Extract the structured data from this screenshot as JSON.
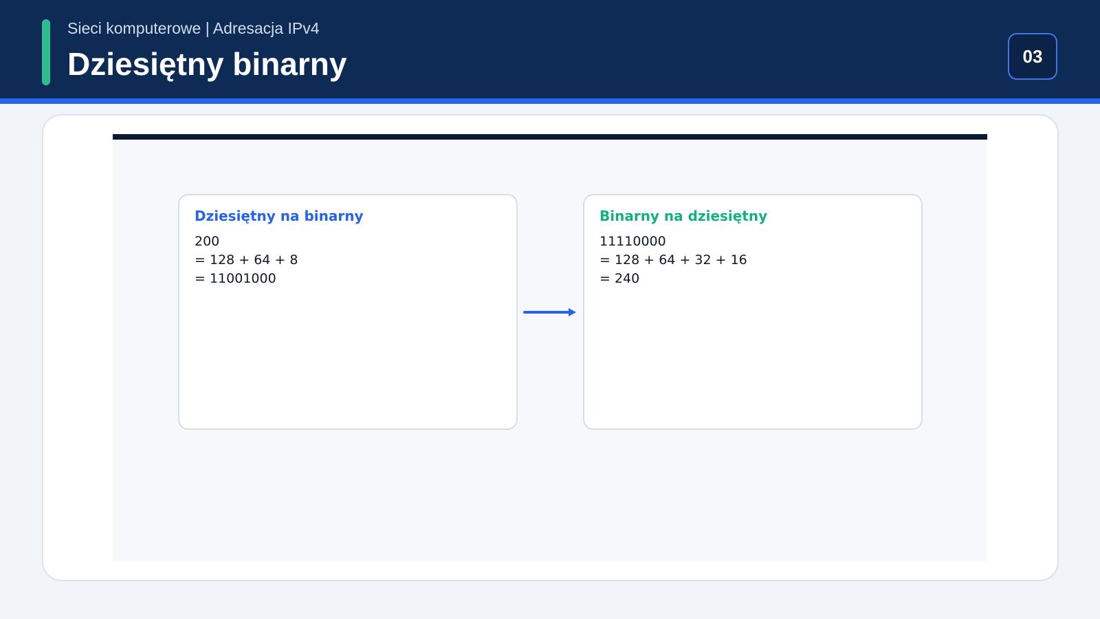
{
  "header": {
    "subtitle": "Sieci komputerowe | Adresacja IPv4",
    "title": "Dziesiętny binarny",
    "page_number": "03"
  },
  "colors": {
    "header_bg": "#0d2b55",
    "header_stripe": "#2563eb",
    "accent": "#2ebd90",
    "left_title": "#2563eb",
    "right_title": "#14b27a"
  },
  "cards": [
    {
      "title": "Dziesiętny na binarny",
      "lines": [
        "200",
        "= 128 + 64 + 8",
        "= 11001000"
      ]
    },
    {
      "title": "Binarny na dziesiętny",
      "lines": [
        "11110000",
        "= 128 + 64 + 32 + 16",
        "= 240"
      ]
    }
  ],
  "icons": {
    "connector": "arrow-right-icon"
  }
}
